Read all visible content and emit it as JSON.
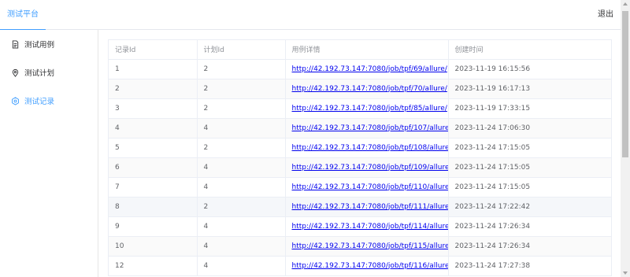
{
  "header": {
    "brand": "测试平台",
    "logout": "退出"
  },
  "sidebar": {
    "items": [
      {
        "label": "测试用例",
        "icon": "document-icon"
      },
      {
        "label": "测试计划",
        "icon": "location-icon"
      },
      {
        "label": "测试记录",
        "icon": "gear-icon",
        "active": true
      }
    ]
  },
  "table": {
    "columns": [
      "记录Id",
      "计划Id",
      "用例详情",
      "创建时间"
    ],
    "rows": [
      {
        "record_id": "1",
        "plan_id": "2",
        "detail": "http://42.192.73.147:7080/job/tpf/69/allure/",
        "created": "2023-11-19 16:15:56"
      },
      {
        "record_id": "2",
        "plan_id": "2",
        "detail": "http://42.192.73.147:7080/job/tpf/70/allure/",
        "created": "2023-11-19 16:17:13"
      },
      {
        "record_id": "3",
        "plan_id": "2",
        "detail": "http://42.192.73.147:7080/job/tpf/85/allure/",
        "created": "2023-11-19 17:33:15"
      },
      {
        "record_id": "4",
        "plan_id": "4",
        "detail": "http://42.192.73.147:7080/job/tpf/107/allure/",
        "created": "2023-11-24 17:06:30"
      },
      {
        "record_id": "5",
        "plan_id": "2",
        "detail": "http://42.192.73.147:7080/job/tpf/108/allure/",
        "created": "2023-11-24 17:15:05"
      },
      {
        "record_id": "6",
        "plan_id": "4",
        "detail": "http://42.192.73.147:7080/job/tpf/109/allure/",
        "created": "2023-11-24 17:15:05"
      },
      {
        "record_id": "7",
        "plan_id": "4",
        "detail": "http://42.192.73.147:7080/job/tpf/110/allure/",
        "created": "2023-11-24 17:15:05"
      },
      {
        "record_id": "8",
        "plan_id": "2",
        "detail": "http://42.192.73.147:7080/job/tpf/111/allure/",
        "created": "2023-11-24 17:22:42"
      },
      {
        "record_id": "9",
        "plan_id": "4",
        "detail": "http://42.192.73.147:7080/job/tpf/114/allure/",
        "created": "2023-11-24 17:26:34"
      },
      {
        "record_id": "10",
        "plan_id": "4",
        "detail": "http://42.192.73.147:7080/job/tpf/115/allure/",
        "created": "2023-11-24 17:26:34"
      },
      {
        "record_id": "12",
        "plan_id": "4",
        "detail": "http://42.192.73.147:7080/job/tpf/116/allure/",
        "created": "2023-11-24 17:27:38"
      }
    ]
  },
  "colors": {
    "accent": "#409eff",
    "link": "#0000ee",
    "border": "#ebeef5"
  }
}
